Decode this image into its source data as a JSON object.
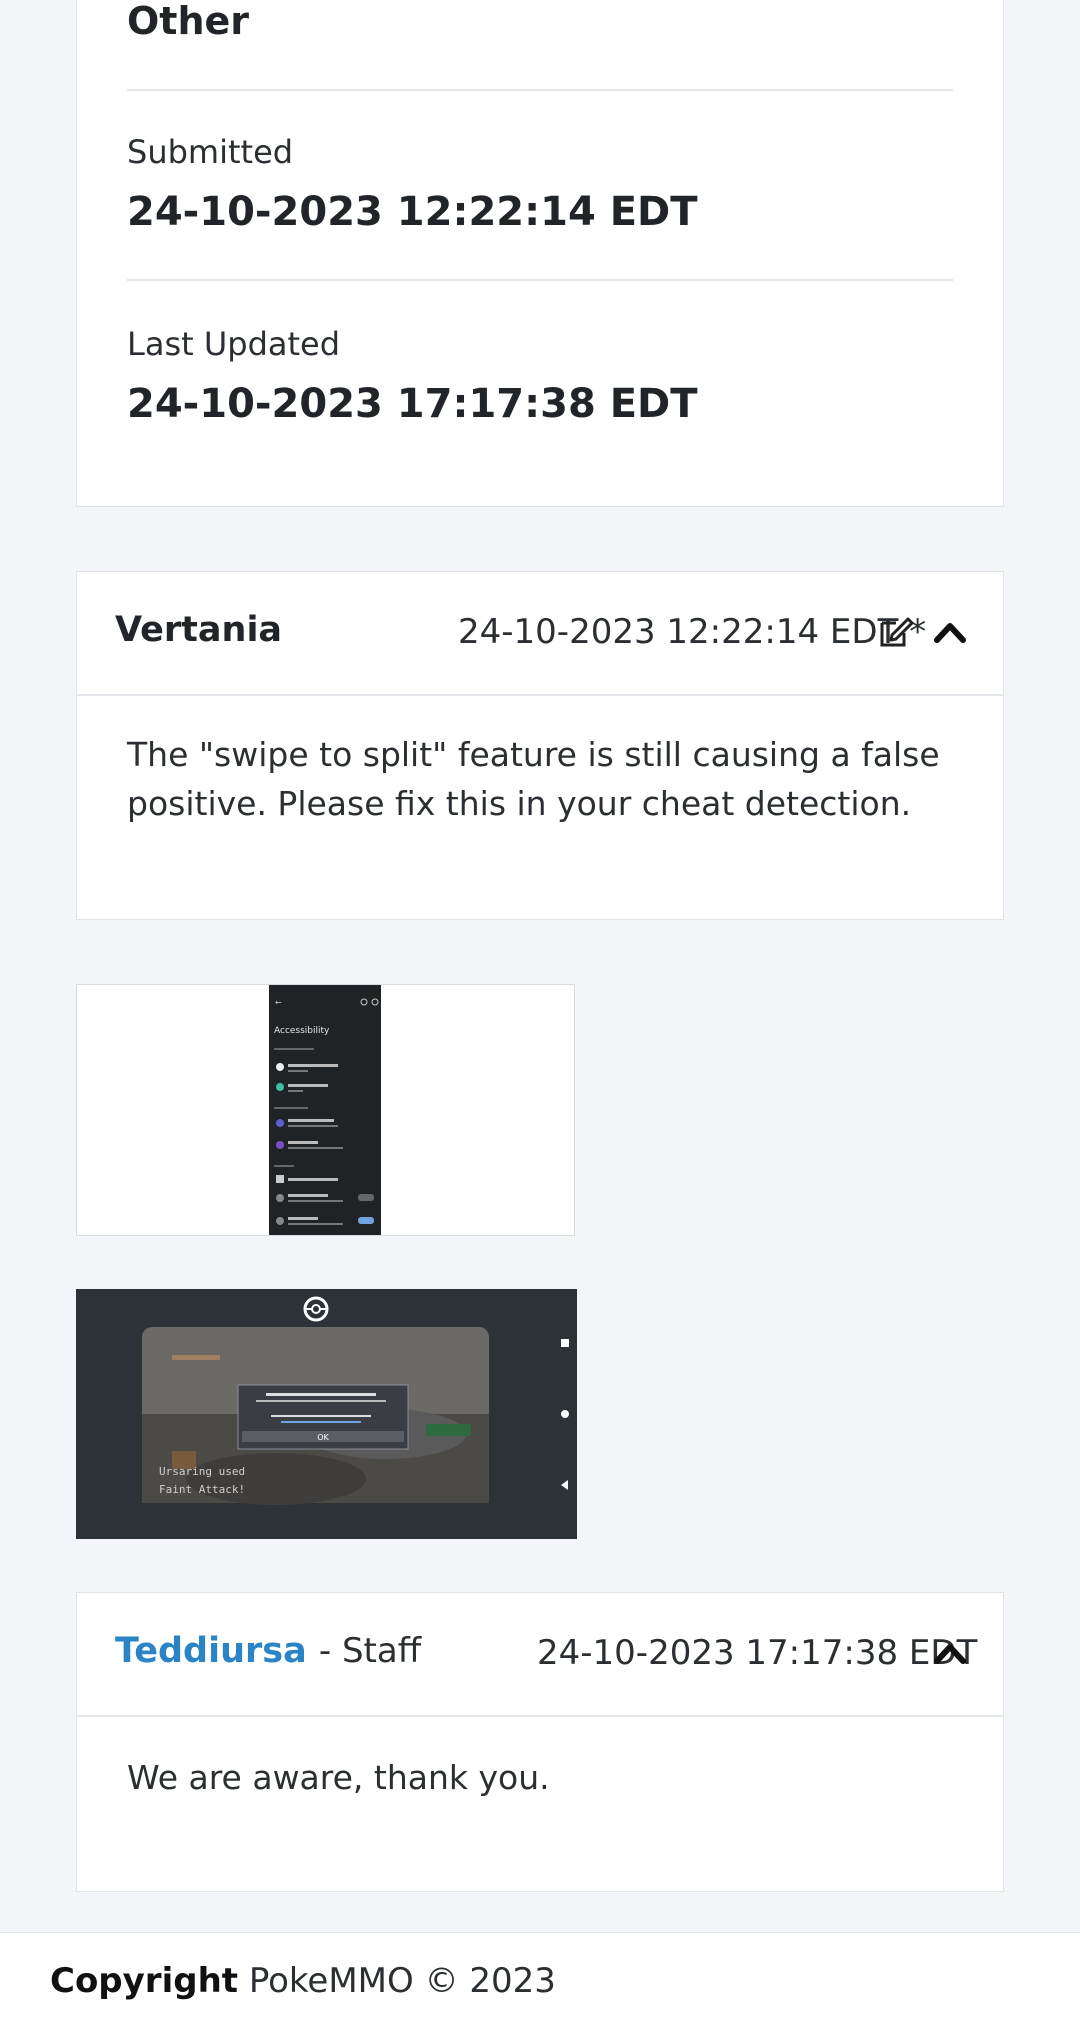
{
  "ticket": {
    "category_value": "Other",
    "submitted_label": "Submitted",
    "submitted_value": "24-10-2023 12:22:14 EDT",
    "updated_label": "Last Updated",
    "updated_value": "24-10-2023 17:17:38 EDT"
  },
  "messages": [
    {
      "author": "Vertania",
      "date": "24-10-2023 12:22:14 EDT *",
      "body": "The \"swipe to split\" feature is still causing a false positive. Please fix this in your cheat detection.",
      "icons": [
        "edit-icon",
        "chevron-up-icon"
      ]
    },
    {
      "author": "Teddiursa",
      "role": "- Staff",
      "date": "24-10-2023 17:17:38 EDT",
      "body": "We are aware, thank you.",
      "icons": [
        "chevron-up-icon"
      ]
    }
  ],
  "attachments": {
    "screenshot1": {
      "title": "Accessibility",
      "items": [
        "Installed Services",
        "Swipe to Split",
        "Select to Speak",
        "TalkBack",
        "Text and display",
        "Extra dim",
        "One-handed"
      ]
    },
    "screenshot2": {
      "battle_line1": "Ursaring used",
      "battle_line2": "Faint Attack!",
      "ok_label": "OK"
    }
  },
  "footer": {
    "copyright_label": "Copyright",
    "copyright_text": "PokeMMO © 2023"
  },
  "colors": {
    "page_bg": "#f3f5f9",
    "link": "#2b84c6",
    "card_border": "#dfe3e8"
  }
}
